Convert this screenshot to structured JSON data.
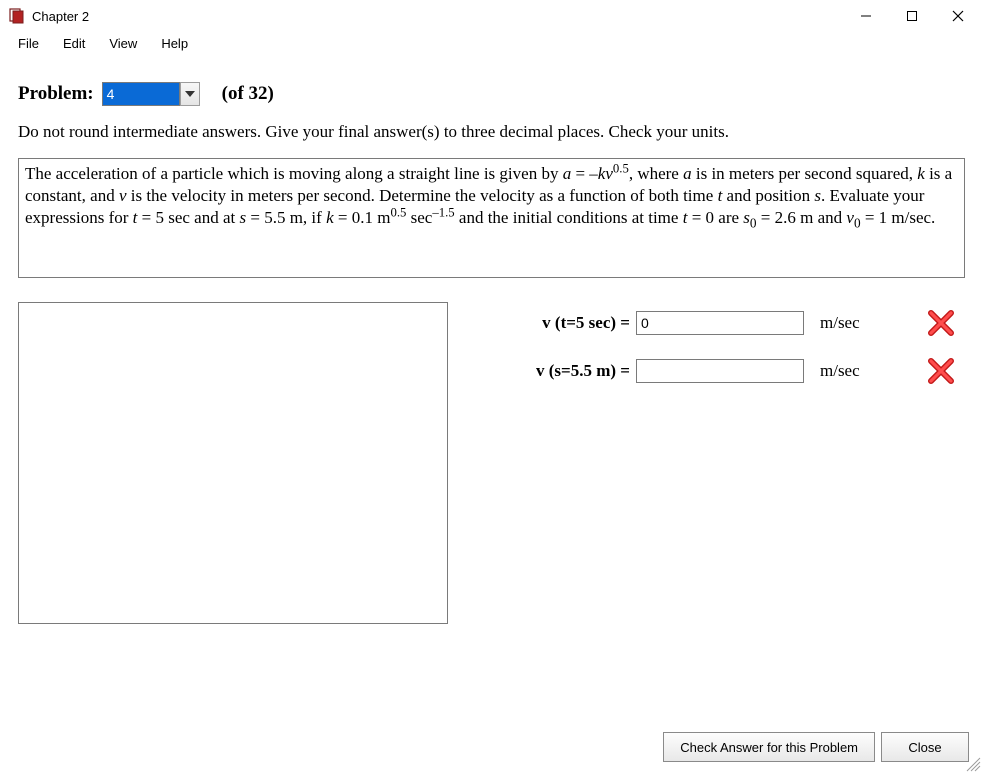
{
  "window": {
    "title": "Chapter 2"
  },
  "menu": {
    "items": [
      "File",
      "Edit",
      "View",
      "Help"
    ]
  },
  "problem": {
    "label": "Problem:",
    "number": "4",
    "of_total": "(of 32)"
  },
  "instruction": "Do not round intermediate answers.  Give your final answer(s) to three decimal places.  Check your units.",
  "problem_text": {
    "pre_a": "The acceleration of a particle which is moving along a straight line is given by ",
    "a_var": "a",
    "eq": " = –",
    "k_var": "k",
    "v_var": "v",
    "exp05": "0.5",
    "post_a1": ", where ",
    "post_a2": " is in meters per second squared, ",
    "post_a3": " is a constant, and ",
    "post_a4": " is the velocity in meters per second. Determine the velocity as a function of both time ",
    "t_var": "t",
    "post_a5": " and position ",
    "s_var": "s",
    "post_a6": ". Evaluate your expressions for ",
    "t_eq": " = 5 sec and at ",
    "s_eq": " = 5.5 m, if ",
    "k_eq": " = 0.1 m",
    "m_exp": "0.5",
    "sec_txt": " sec",
    "sec_exp": "–1.5",
    "tail1": " and the initial conditions at time ",
    "t0": " = 0 are ",
    "s0_var": "s",
    "s0_sub": "0",
    "s0_val": " = 2.6 m and ",
    "v0_var": "v",
    "v0_sub": "0",
    "v0_val": " = 1 m/sec."
  },
  "answers": {
    "rows": [
      {
        "label": "v (t=5 sec) = ",
        "value": "0",
        "unit": "m/sec",
        "correct": false
      },
      {
        "label": "v (s=5.5 m) = ",
        "value": "",
        "unit": "m/sec",
        "correct": false
      }
    ]
  },
  "buttons": {
    "check": "Check Answer for this Problem",
    "close": "Close"
  }
}
